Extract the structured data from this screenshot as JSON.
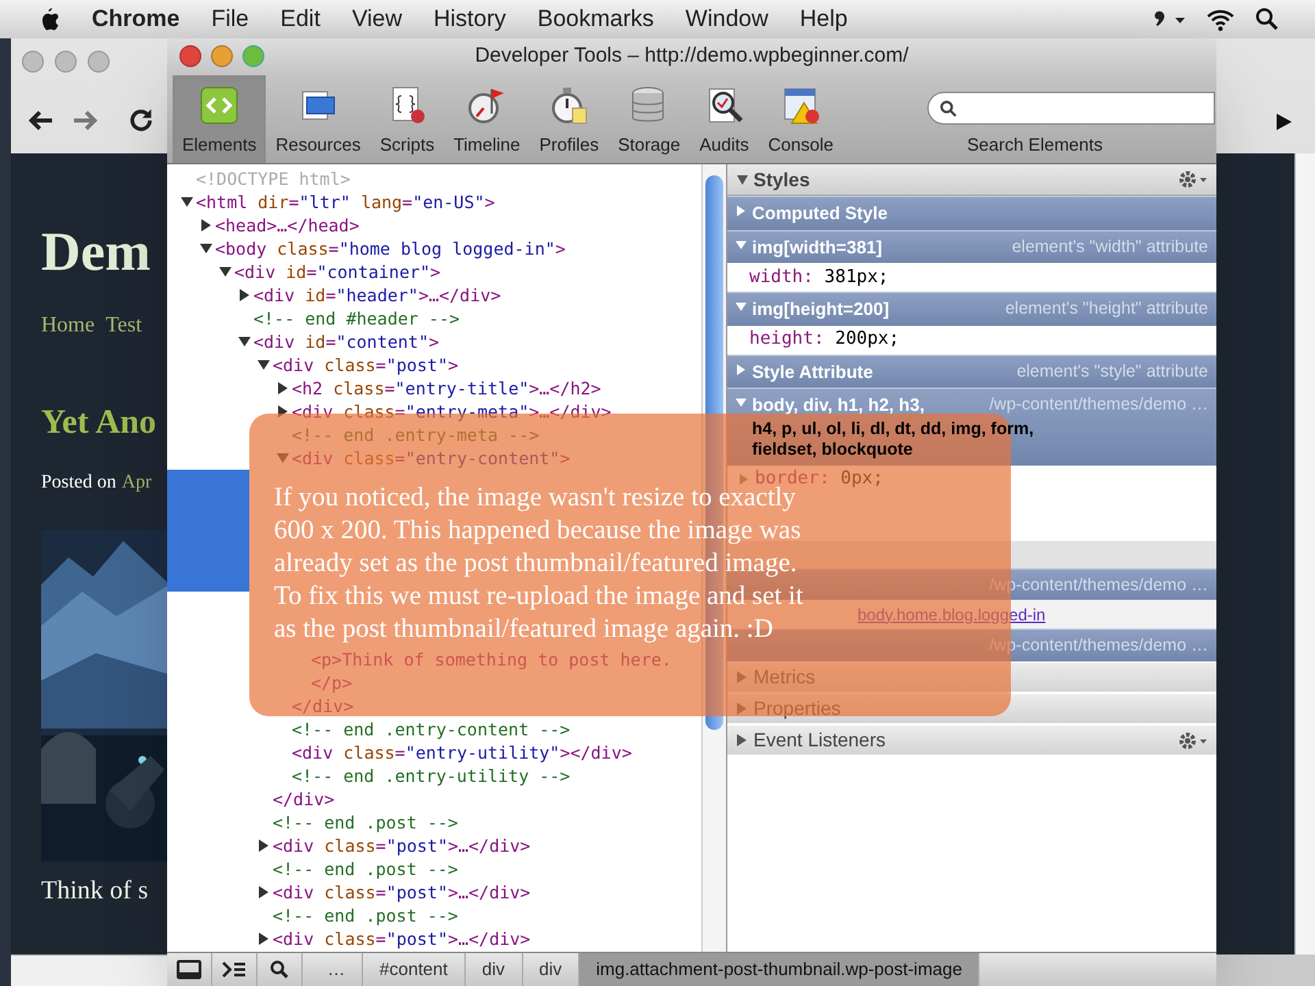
{
  "menu_bar": {
    "app": "Chrome",
    "items": [
      "File",
      "Edit",
      "View",
      "History",
      "Bookmarks",
      "Window",
      "Help"
    ]
  },
  "browser": {
    "page": {
      "site_title": "Dem",
      "nav": [
        "Home",
        "Test"
      ],
      "post_title": "Yet Ano",
      "posted_label": "Posted on",
      "posted_date": "Apr",
      "excerpt": "Think of s",
      "image": {
        "kind": "picture"
      }
    }
  },
  "devtools": {
    "title": "Developer Tools – http://demo.wpbeginner.com/",
    "tabs": [
      {
        "label": "Elements",
        "selected": true
      },
      {
        "label": "Resources",
        "selected": false
      },
      {
        "label": "Scripts",
        "selected": false
      },
      {
        "label": "Timeline",
        "selected": false
      },
      {
        "label": "Profiles",
        "selected": false
      },
      {
        "label": "Storage",
        "selected": false
      },
      {
        "label": "Audits",
        "selected": false
      },
      {
        "label": "Console",
        "selected": false
      }
    ],
    "search_label": "Search Elements",
    "dom_tree": [
      {
        "kind": "doctype",
        "text": "<!DOCTYPE html>"
      },
      {
        "kind": "tag",
        "text": "<html dir=\"ltr\" lang=\"en-US\">",
        "expanded": true,
        "children": [
          {
            "kind": "tag",
            "text": "<head>…</head>",
            "expanded": false
          },
          {
            "kind": "tag",
            "text": "<body class=\"home blog logged-in\">",
            "expanded": true,
            "children": [
              {
                "kind": "tag",
                "text": "<div id=\"container\">",
                "expanded": true,
                "children": [
                  {
                    "kind": "tag",
                    "text": "<div id=\"header\">…</div>",
                    "expanded": false
                  },
                  {
                    "kind": "comment",
                    "text": "<!-- end #header -->"
                  },
                  {
                    "kind": "tag",
                    "text": "<div id=\"content\">",
                    "expanded": true,
                    "children": [
                      {
                        "kind": "tag",
                        "text": "<div class=\"post\">",
                        "expanded": true,
                        "close": "</div>",
                        "children": [
                          {
                            "kind": "tag",
                            "text": "<h2 class=\"entry-title\">…</h2>",
                            "expanded": false
                          },
                          {
                            "kind": "tag",
                            "text": "<div class=\"entry-meta\">…</div>",
                            "expanded": false
                          },
                          {
                            "kind": "comment",
                            "text": "<!-- end .entry-meta -->"
                          },
                          {
                            "kind": "tag",
                            "text": "<div class=\"entry-content\">",
                            "expanded": true,
                            "close": "</div>",
                            "children": [
                              {
                                "kind": "covered"
                              },
                              {
                                "kind": "tag",
                                "text": "<p>Think of something to post here.</p>"
                              }
                            ]
                          },
                          {
                            "kind": "comment",
                            "text": "<!-- end .entry-content -->"
                          },
                          {
                            "kind": "tag",
                            "text": "<div class=\"entry-utility\"></div>"
                          },
                          {
                            "kind": "comment",
                            "text": "<!-- end .entry-utility -->"
                          }
                        ]
                      },
                      {
                        "kind": "comment",
                        "text": "<!-- end .post -->"
                      },
                      {
                        "kind": "tag",
                        "text": "<div class=\"post\">…</div>",
                        "expanded": false
                      },
                      {
                        "kind": "comment",
                        "text": "<!-- end .post -->"
                      },
                      {
                        "kind": "tag",
                        "text": "<div class=\"post\">…</div>",
                        "expanded": false
                      },
                      {
                        "kind": "comment",
                        "text": "<!-- end .post -->"
                      },
                      {
                        "kind": "tag",
                        "text": "<div class=\"post\">…</div>",
                        "expanded": false
                      }
                    ]
                  }
                ]
              }
            ]
          }
        ]
      }
    ],
    "styles": {
      "header": "Styles",
      "rows": [
        {
          "kind": "section",
          "selector": "Computed Style",
          "expanded": false
        },
        {
          "kind": "section",
          "selector": "img[width=381]",
          "source": "element's \"width\" attribute",
          "expanded": true
        },
        {
          "kind": "property",
          "name": "width:",
          "value": "381px;"
        },
        {
          "kind": "section",
          "selector": "img[height=200]",
          "source": "element's \"height\" attribute",
          "expanded": true
        },
        {
          "kind": "property",
          "name": "height:",
          "value": "200px;"
        },
        {
          "kind": "section",
          "selector": "Style Attribute",
          "source": "element's \"style\" attribute",
          "expanded": false
        },
        {
          "kind": "section",
          "selector": "body, div, h1, h2, h3,",
          "selector_more": "h4, p, ul, ol, li, dl, dt, dd, img, form, fieldset, blockquote",
          "source": "/wp-content/themes/demo …",
          "expanded": true
        },
        {
          "kind": "property",
          "name": "border:",
          "value": "0px;",
          "expandable": true
        },
        {
          "kind": "covered"
        },
        {
          "kind": "section",
          "source": "/wp-content/themes/demo …"
        },
        {
          "kind": "inherited",
          "link": "body.home.blog.logged-in"
        },
        {
          "kind": "section",
          "source": "/wp-content/themes/demo …"
        }
      ]
    },
    "panes": [
      {
        "kind": "pane",
        "label": "Metrics",
        "gear": false
      },
      {
        "kind": "pane",
        "label": "Properties",
        "gear": false
      },
      {
        "kind": "pane",
        "label": "Event Listeners",
        "gear": true
      }
    ],
    "breadcrumbs": [
      {
        "label": "…",
        "selected": false
      },
      {
        "label": "#content",
        "selected": false
      },
      {
        "label": "div",
        "selected": false
      },
      {
        "label": "div",
        "selected": false
      },
      {
        "label": "img.attachment-post-thumbnail.wp-post-image",
        "selected": true
      }
    ]
  },
  "caption": {
    "lines": [
      "If you noticed, the image wasn't resize to exactly",
      "600 x 200. This happened because the image was",
      "already set as the post thumbnail/featured image.",
      "To fix this we must re-upload the image and set it",
      "as the post thumbnail/featured image again. :D"
    ]
  }
}
